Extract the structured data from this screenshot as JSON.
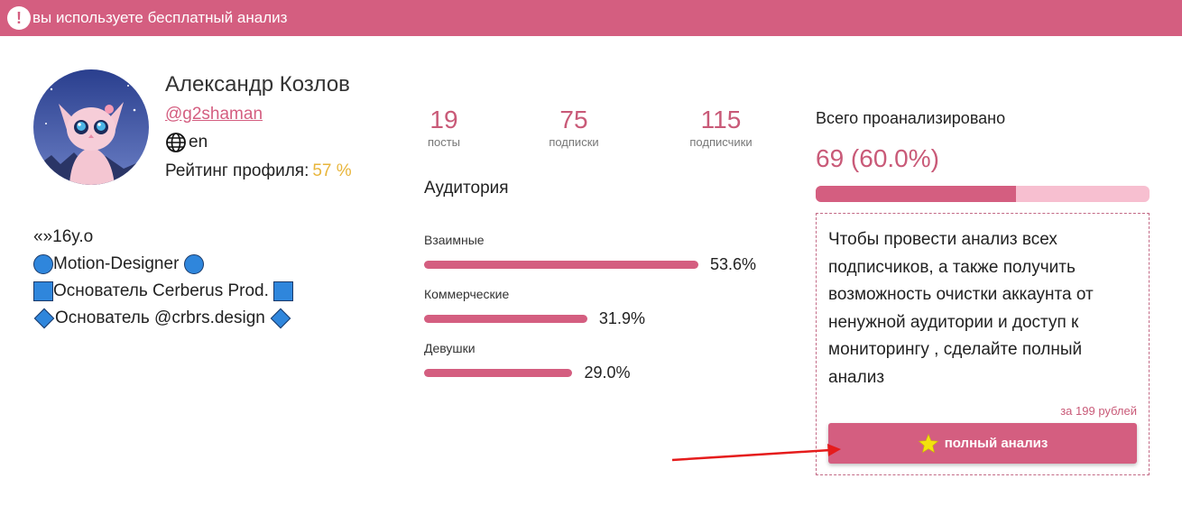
{
  "banner": {
    "icon": "exclamation-icon",
    "icon_glyph": "!",
    "text": "вы используете бесплатный анализ"
  },
  "profile": {
    "name": "Александр Козлов",
    "handle": "@g2shaman",
    "language": "en",
    "rating_label": "Рейтинг профиля:",
    "rating_value": "57 %",
    "bio": {
      "line1": "«»16y.o",
      "line2": "Motion-Designer",
      "line3": "Основатель Cerberus Prod.",
      "line4": "Основатель @crbrs.design"
    }
  },
  "stats": {
    "posts": {
      "value": "19",
      "label": "посты"
    },
    "following": {
      "value": "75",
      "label": "подписки"
    },
    "followers": {
      "value": "115",
      "label": "подписчики"
    }
  },
  "audience": {
    "title": "Аудитория",
    "items": [
      {
        "label": "Взаимные",
        "value": "53.6%",
        "percent": 53.6
      },
      {
        "label": "Коммерческие",
        "value": "31.9%",
        "percent": 31.9
      },
      {
        "label": "Девушки",
        "value": "29.0%",
        "percent": 29.0
      }
    ]
  },
  "analysis": {
    "title": "Всего проанализировано",
    "value": "69 (60.0%)",
    "progress_percent": 60.0,
    "promo_text": "Чтобы провести анализ всех подписчиков, а также получить возможность очистки аккаунта от ненужной аудитории и доступ к мониторингу , сделайте полный анализ",
    "price": "за 199 рублей",
    "button_label": "полный анализ",
    "button_icon": "star-icon"
  },
  "colors": {
    "accent": "#d45e80",
    "accent_light": "#f7bfd0",
    "rating": "#e8b53a",
    "star": "#f2e10f",
    "arrow": "#e51c1c"
  }
}
